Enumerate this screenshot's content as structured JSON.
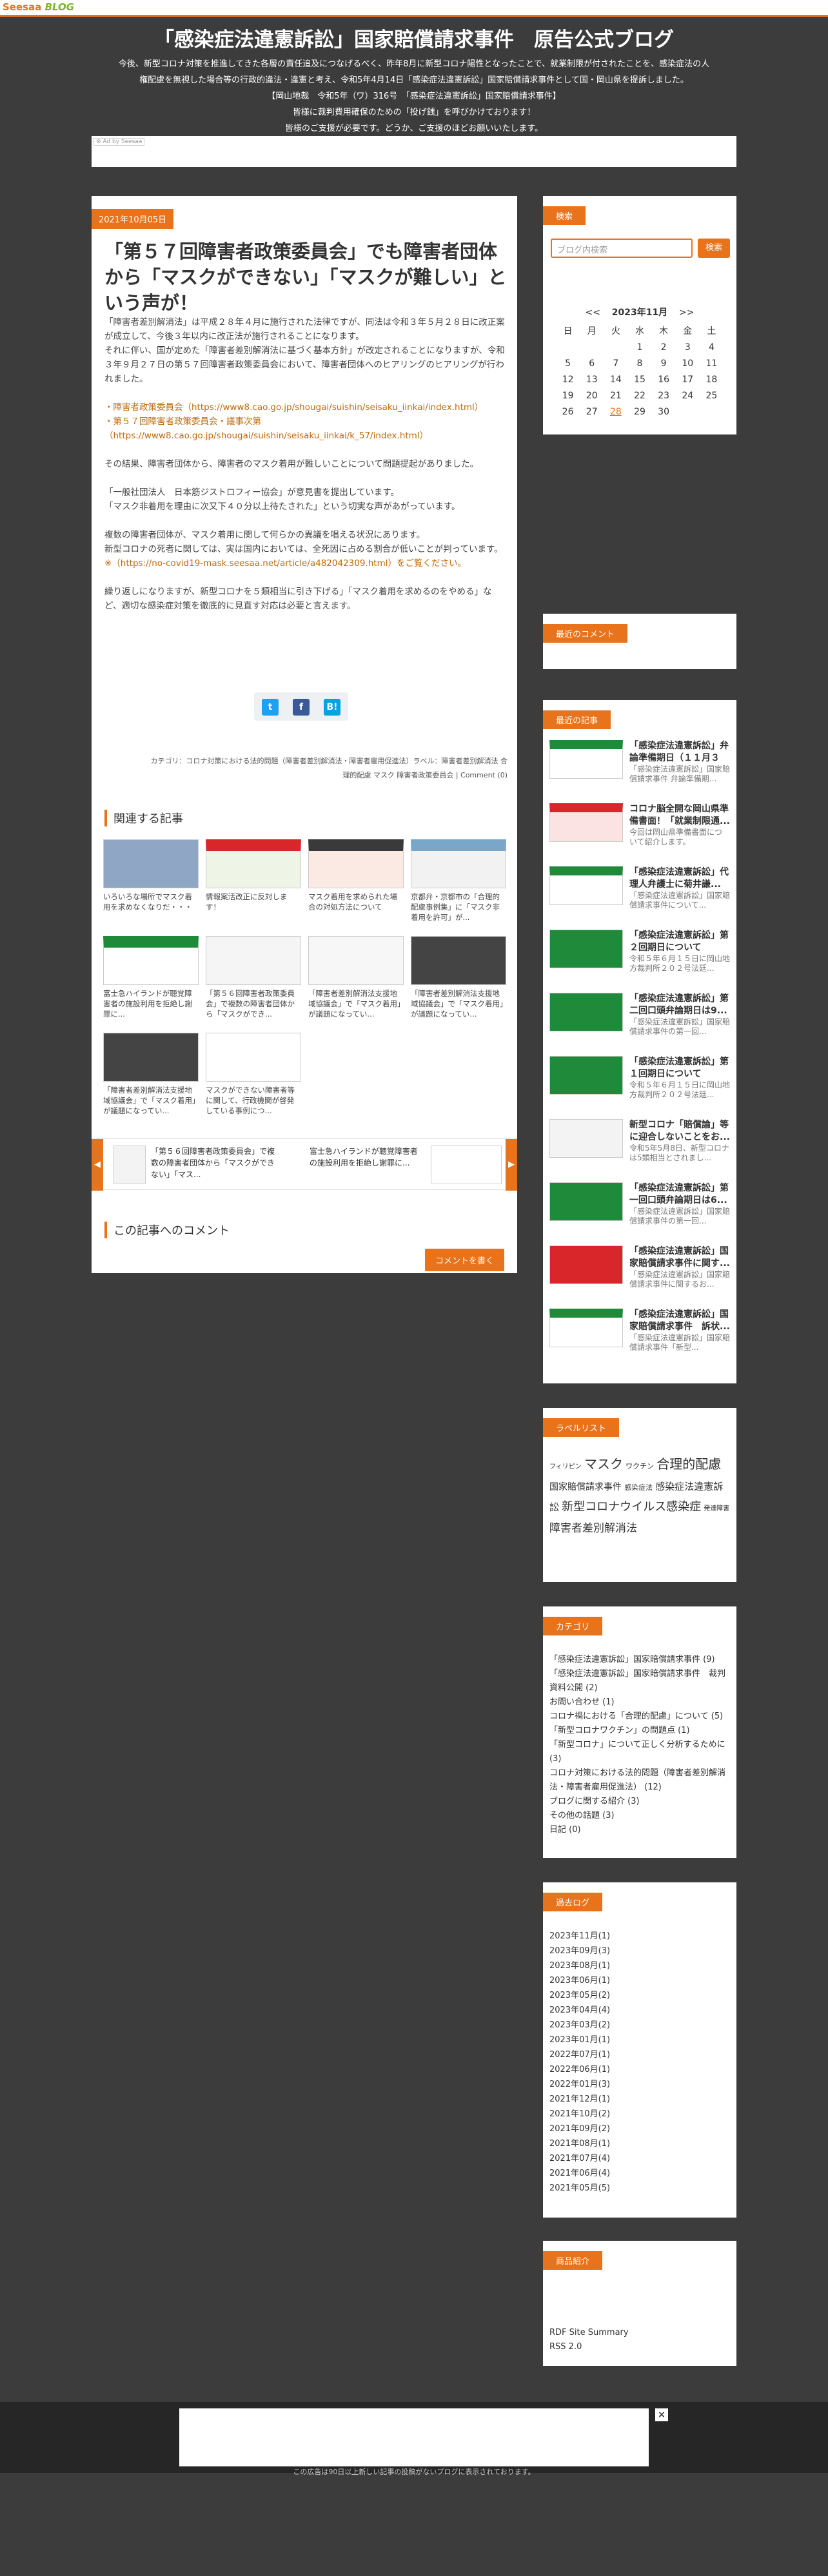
{
  "brand": {
    "name": "Seesaa",
    "suffix": "BLOG"
  },
  "header": {
    "title": "「感染症法違憲訴訟」国家賠償請求事件　原告公式ブログ",
    "desc": [
      "今後、新型コロナ対策を推進してきた各層の責任追及につなげるべく、昨年8月に新型コロナ陽性となったことで、就業制限が付されたことを、感染症法の人",
      "権配慮を無視した場合等の行政的違法・違憲と考え、令和5年4月14日「感染症法違憲訴訟」国家賠償請求事件として国・岡山県を提訴しました。",
      "【岡山地裁　令和5年（ワ）316号　「感染症法違憲訴訟」国家賠償請求事件】",
      "皆様に裁判費用確保のための「投げ銭」を呼びかけております！",
      "皆様のご支援が必要です。どうか、ご支援のほどお願いいたします。"
    ]
  },
  "ad_tag": "⊗ Ad by Seesaa",
  "article": {
    "date": "2021年10月05日",
    "title": "「第５７回障害者政策委員会」でも障害者団体から「マスクができない」「マスクが難しい」という声が！",
    "paragraphs": [
      [
        "「障害者差別解消法」は平成２８年４月に施行された法律ですが、同法は令和３年５月２８日に改正案が成立して、今後３年以内に改正法が施行されることになります。",
        "それに伴い、国が定めた「障害者差別解消法に基づく基本方針」が改定されることになりますが、令和３年９月２７日の第５７回障害者政策委員会において、障害者団体へのヒアリングのヒアリングが行われました。"
      ],
      [
        "・障害者政策委員会（https://www8.cao.go.jp/shougai/suishin/seisaku_iinkai/index.html）",
        "・第５７回障害者政策委員会・議事次第（https://www8.cao.go.jp/shougai/suishin/seisaku_iinkai/k_57/index.html）"
      ],
      [
        "その結果、障害者団体から、障害者のマスク着用が難しいことについて問題提起がありました。"
      ],
      [
        "「一般社団法人　日本筋ジストロフィー協会」が意見書を提出しています。",
        "「マスク非着用を理由に次又下４０分以上待たされた」という切実な声があがっています。"
      ],
      [
        "複数の障害者団体が、マスク着用に関して何らかの異議を唱える状況にあります。",
        "新型コロナの死者に関しては、実は国内においては、全死因に占める割合が低いことが判っています。",
        "※（https://no-covid19-mask.seesaa.net/article/a482042309.html）をご覧ください。"
      ],
      [
        "繰り返しになりますが、新型コロナを５類相当に引き下げる」「マスク着用を求めるのをやめる」など、適切な感染症対策を徹底的に見直す対応は必要と言えます。"
      ]
    ],
    "meta": [
      "カテゴリ：コロナ対策における法的問題（障害者差別解消法・障害者雇用促進法）ラベル：障害者差別解消法 合",
      "理的配慮 マスク 障害者政策委員会 | Comment (0)"
    ]
  },
  "related": {
    "heading": "関連する記事",
    "items": [
      "いろいろな場所でマスク着用を求めなくなりだ・・・",
      "情報案活改正に反対します！",
      "マスク着用を求められた場合の対処方法について",
      "京都弁・京都市の「合理的配慮事例集」に「マスク非着用を許可」が...",
      "富士急ハイランドが聴覚障害者の施設利用を拒絶し謝罪に...",
      "「第５６回障害者政策委員会」で複数の障害者団体から「マスクができ...",
      "「障害者差別解消法支援地域協議会」で「マスク着用」が議題になってい...",
      "「障害者差別解消法支援地域協議会」で「マスク着用」が議題になってい...",
      "「障害者差別解消法支援地域協議会」で「マスク着用」が議題になってい...",
      "マスクができない障害者等に関して、行政機関が啓発している事例につ..."
    ],
    "carousel": [
      "「第５６回障害者政策委員会」で複数の障害者団体から「マスクができない」「マス...",
      "富士急ハイランドが聴覚障害者の施設利用を拒絶し謝罪に..."
    ]
  },
  "comment": {
    "heading": "この記事へのコメント",
    "button": "コメントを書く"
  },
  "sidebar": {
    "search": {
      "title": "検索",
      "placeholder": "ブログ内検索",
      "button": "検索"
    },
    "calendar": {
      "prev": "<<",
      "month": "2023年11月",
      "next": ">>",
      "weekdays": [
        "日",
        "月",
        "火",
        "水",
        "木",
        "金",
        "土"
      ],
      "weeks": [
        [
          "",
          "",
          "",
          "1",
          "2",
          "3",
          "4"
        ],
        [
          "5",
          "6",
          "7",
          "8",
          "9",
          "10",
          "11"
        ],
        [
          "12",
          "13",
          "14",
          "15",
          "16",
          "17",
          "18"
        ],
        [
          "19",
          "20",
          "21",
          "22",
          "23",
          "24",
          "25"
        ],
        [
          "26",
          "27",
          "28",
          "29",
          "30",
          "",
          ""
        ]
      ]
    },
    "recent_comments": {
      "title": "最近のコメント"
    },
    "recent_posts": {
      "title": "最近の記事",
      "items": [
        {
          "title": "「感染症法違憲訴訟」弁論準備期日（１１月３０...",
          "sub": "「感染症法違憲訴訟」国家賠償請求事件 弁論準備期..."
        },
        {
          "title": "コロナ脳全開な岡山県準備書面！「就業制限通...",
          "sub": "今回は岡山県準備書面について紹介します。"
        },
        {
          "title": "「感染症法違憲訴訟」代理人弁護士に菊井謙...",
          "sub": "「感染症法違憲訴訟」国家賠償請求事件について..."
        },
        {
          "title": "「感染症法違憲訴訟」第２回期日について",
          "sub": "令和５年６月１５日に岡山地方裁判所２０２号法廷..."
        },
        {
          "title": "「感染症法違憲訴訟」第二回口頭弁論期日は9...",
          "sub": "「感染症法違憲訴訟」国家賠償請求事件の第一回..."
        },
        {
          "title": "「感染症法違憲訴訟」第１回期日について",
          "sub": "令和５年６月１５日に岡山地方裁判所２０２号法廷..."
        },
        {
          "title": "新型コロナ「賠償論」等に迎合しないことをお...",
          "sub": "令和5年5月8日、新型コロナは5類相当とされまし..."
        },
        {
          "title": "「感染症法違憲訴訟」第一回口頭弁論期日は6...",
          "sub": "「感染症法違憲訴訟」国家賠償請求事件の第一回..."
        },
        {
          "title": "「感染症法違憲訴訟」国家賠償請求事件に関す...",
          "sub": "「感染症法違憲訴訟」国家賠償請求事件に関するお..."
        },
        {
          "title": "「感染症法違憲訴訟」国家賠償請求事件　訴状...",
          "sub": "「感染症法違憲訴訟」国家賠償請求事件「新型..."
        }
      ]
    },
    "labels": {
      "title": "ラベルリスト",
      "items": [
        {
          "t": "フィリピン",
          "s": 10
        },
        {
          "t": "マスク",
          "s": 20
        },
        {
          "t": "ワクチン",
          "s": 11
        },
        {
          "t": "合理的配慮",
          "s": 20
        },
        {
          "t": "国家賠償請求事件",
          "s": 14
        },
        {
          "t": "感染症法",
          "s": 11
        },
        {
          "t": "感染症法違憲訴訟",
          "s": 15
        },
        {
          "t": "新型コロナウイルス感染症",
          "s": 18
        },
        {
          "t": "発達障害",
          "s": 10
        },
        {
          "t": "障害者差別解消法",
          "s": 17
        }
      ]
    },
    "categories": {
      "title": "カテゴリ",
      "items": [
        "「感染症法違憲訴訟」国家賠償請求事件 (9)",
        "「感染症法違憲訴訟」国家賠償請求事件　裁判資料公開 (2)",
        "お問い合わせ (1)",
        "コロナ禍における「合理的配慮」について (5)",
        "「新型コロナワクチン」の問題点 (1)",
        "「新型コロナ」について正しく分析するために (3)",
        "コロナ対策における法的問題（障害者差別解消法・障害者雇用促進法） (12)",
        "ブログに関する紹介 (3)",
        "その他の話題 (3)",
        "日記 (0)"
      ]
    },
    "archives": {
      "title": "過去ログ",
      "items": [
        "2023年11月(1)",
        "2023年09月(3)",
        "2023年08月(1)",
        "2023年06月(1)",
        "2023年05月(2)",
        "2023年04月(4)",
        "2023年03月(2)",
        "2023年01月(1)",
        "2022年07月(1)",
        "2022年06月(1)",
        "2022年01月(3)",
        "2021年12月(1)",
        "2021年10月(2)",
        "2021年09月(2)",
        "2021年08月(1)",
        "2021年07月(4)",
        "2021年06月(4)",
        "2021年05月(5)"
      ]
    },
    "products": {
      "title": "商品紹介",
      "items": [
        "RDF Site Summary",
        "RSS 2.0"
      ]
    }
  },
  "footer": {
    "note": "この広告は90日以上新しい記事の投稿がないブログに表示されております。",
    "close": "×"
  },
  "colors": {
    "accent": "#e8731a",
    "bg": "#3c3c3c"
  }
}
